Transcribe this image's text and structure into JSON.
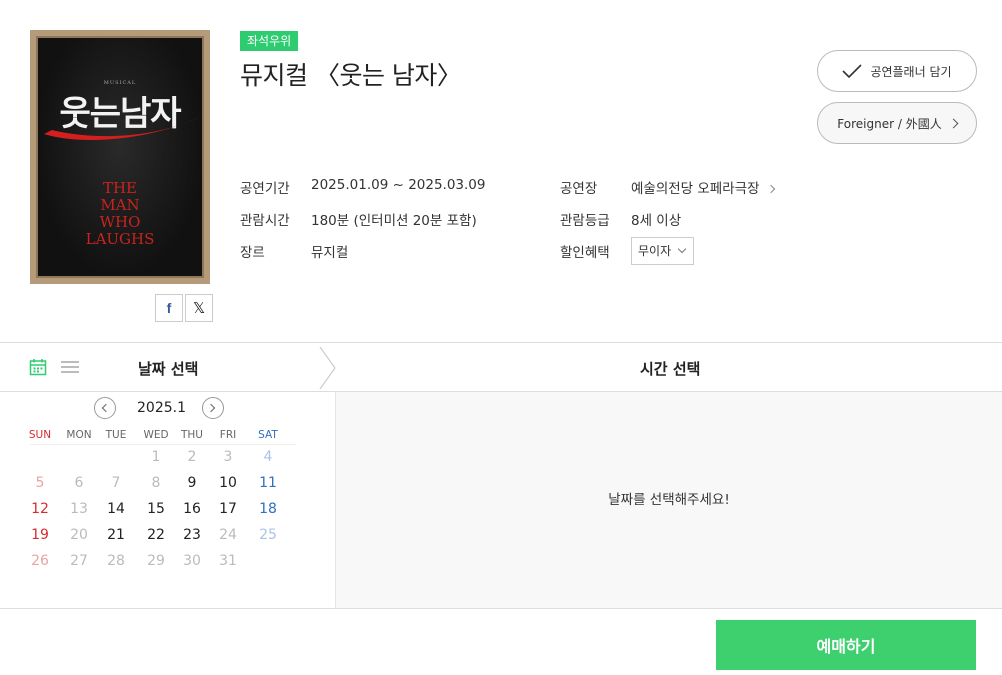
{
  "poster": {
    "musical_label": "MUSICAL",
    "korean_title": "웃는남자",
    "english_lines": [
      "THE",
      "MAN",
      "WHO",
      "LAUGHS"
    ]
  },
  "badge": "좌석우위",
  "title": "뮤지컬 〈웃는 남자〉",
  "buttons": {
    "planner": "공연플래너 담기",
    "foreigner": "Foreigner / 外國人"
  },
  "info": {
    "period_label": "공연기간",
    "period_value": "2025.01.09 ~ 2025.03.09",
    "runtime_label": "관람시간",
    "runtime_value": "180분 (인터미션 20분 포함)",
    "genre_label": "장르",
    "genre_value": "뮤지컬",
    "venue_label": "공연장",
    "venue_value": "예술의전당 오페라극장",
    "rating_label": "관람등급",
    "rating_value": "8세 이상",
    "discount_label": "할인혜택",
    "discount_value": "무이자"
  },
  "selection": {
    "date_label": "날짜 선택",
    "time_label": "시간 선택",
    "time_empty_message": "날짜를 선택해주세요!"
  },
  "calendar": {
    "month": "2025.1",
    "weekdays": [
      "SUN",
      "MON",
      "TUE",
      "WED",
      "THU",
      "FRI",
      "SAT"
    ],
    "weeks": [
      [
        null,
        null,
        null,
        {
          "d": "1",
          "s": "dim"
        },
        {
          "d": "2",
          "s": "dim"
        },
        {
          "d": "3",
          "s": "dim"
        },
        {
          "d": "4",
          "s": "dim"
        }
      ],
      [
        {
          "d": "5",
          "s": "dim"
        },
        {
          "d": "6",
          "s": "dim"
        },
        {
          "d": "7",
          "s": "dim"
        },
        {
          "d": "8",
          "s": "dim"
        },
        {
          "d": "9",
          "s": "on"
        },
        {
          "d": "10",
          "s": "on"
        },
        {
          "d": "11",
          "s": "on"
        }
      ],
      [
        {
          "d": "12",
          "s": "on"
        },
        {
          "d": "13",
          "s": "dim"
        },
        {
          "d": "14",
          "s": "on"
        },
        {
          "d": "15",
          "s": "on"
        },
        {
          "d": "16",
          "s": "on"
        },
        {
          "d": "17",
          "s": "on"
        },
        {
          "d": "18",
          "s": "on"
        }
      ],
      [
        {
          "d": "19",
          "s": "on"
        },
        {
          "d": "20",
          "s": "dim"
        },
        {
          "d": "21",
          "s": "on"
        },
        {
          "d": "22",
          "s": "on"
        },
        {
          "d": "23",
          "s": "on"
        },
        {
          "d": "24",
          "s": "dim"
        },
        {
          "d": "25",
          "s": "dim"
        }
      ],
      [
        {
          "d": "26",
          "s": "dim"
        },
        {
          "d": "27",
          "s": "dim"
        },
        {
          "d": "28",
          "s": "dim"
        },
        {
          "d": "29",
          "s": "dim"
        },
        {
          "d": "30",
          "s": "dim"
        },
        {
          "d": "31",
          "s": "dim"
        },
        null
      ]
    ]
  },
  "footer": {
    "book_label": "예매하기"
  },
  "colors": {
    "accent_green": "#3ecf6f",
    "badge_green": "#2ecc71",
    "sunday_red": "#d62c2c",
    "saturday_blue": "#2f6fc1"
  }
}
